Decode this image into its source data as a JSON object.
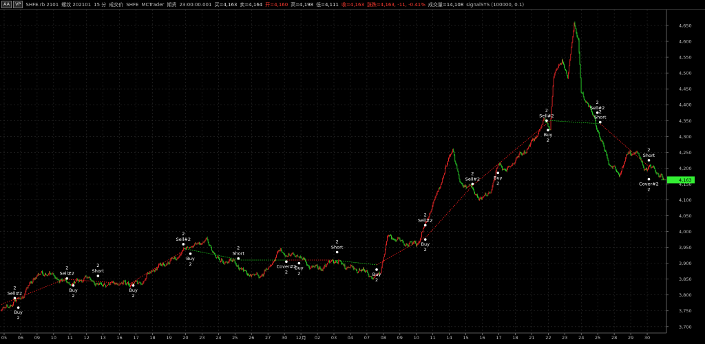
{
  "toolbar": {
    "buttons": [
      "AA",
      "VP"
    ],
    "symbol": "SHFE.rb 2101",
    "instrument": "螺纹 202101",
    "interval": "15 分",
    "tags": [
      "成交价",
      "SHFE",
      "MCTrader",
      "期货"
    ],
    "time": "23:00:00.001",
    "fields": [
      {
        "label": "买",
        "value": "=4,163",
        "red": false
      },
      {
        "label": "卖",
        "value": "=4,164",
        "red": false
      },
      {
        "label": "开",
        "value": "=4,160",
        "red": true
      },
      {
        "label": "高",
        "value": "=4,198",
        "red": false
      },
      {
        "label": "低",
        "value": "=4,111",
        "red": false
      },
      {
        "label": "收",
        "value": "=4,163",
        "red": true
      },
      {
        "label": "涨跌",
        "value": "=4,163, -11, -0.41%",
        "red": true
      },
      {
        "label": "成交量",
        "value": "=14,108",
        "red": false
      }
    ],
    "signal": "signalSYS (100000, 0.1)"
  },
  "chart_data": {
    "type": "candlestick",
    "title": "SHFE.rb 2101 螺纹 202101 15 分",
    "ylim": [
      3680,
      4700
    ],
    "y_ticks": [
      3700,
      3750,
      3800,
      3850,
      3900,
      3950,
      4000,
      4050,
      4100,
      4150,
      4200,
      4250,
      4300,
      4350,
      4400,
      4450,
      4500,
      4550,
      4600,
      4650
    ],
    "y_tick_labels": [
      "3,700",
      "3,750",
      "3,800",
      "3,850",
      "3,900",
      "3,950",
      "4,000",
      "4,050",
      "4,100",
      "4,150",
      "4,200",
      "4,250",
      "4,300",
      "4,350",
      "4,400",
      "4,450",
      "4,500",
      "4,550",
      "4,600",
      "4,650"
    ],
    "x_ticks": [
      "05",
      "06",
      "09",
      "10",
      "11",
      "12",
      "13",
      "16",
      "17",
      "18",
      "19",
      "20",
      "23",
      "24",
      "25",
      "26",
      "27",
      "30",
      "12月",
      "02",
      "03",
      "04",
      "07",
      "08",
      "09",
      "10",
      "11",
      "14",
      "15",
      "16",
      "17",
      "18",
      "21",
      "22",
      "23",
      "24",
      "25",
      "28",
      "29",
      "30"
    ],
    "n_bars": 940,
    "grid": true,
    "last_price": 4163,
    "last_price_label": "4,163",
    "colors": {
      "up": "#ff2a2a",
      "down": "#2ee82e",
      "background": "#000000",
      "last_price_tag": "#33ee33",
      "trend_up": "#ff2020",
      "trend_down": "#22dd22"
    },
    "anchors": [
      [
        0,
        3750
      ],
      [
        15,
        3772
      ],
      [
        30,
        3795
      ],
      [
        48,
        3860
      ],
      [
        65,
        3870
      ],
      [
        85,
        3845
      ],
      [
        100,
        3835
      ],
      [
        120,
        3855
      ],
      [
        140,
        3830
      ],
      [
        160,
        3838
      ],
      [
        182,
        3835
      ],
      [
        200,
        3840
      ],
      [
        215,
        3880
      ],
      [
        235,
        3900
      ],
      [
        250,
        3920
      ],
      [
        265,
        3955
      ],
      [
        275,
        3955
      ],
      [
        290,
        3975
      ],
      [
        296,
        3950
      ],
      [
        310,
        3905
      ],
      [
        330,
        3905
      ],
      [
        345,
        3870
      ],
      [
        365,
        3860
      ],
      [
        380,
        3885
      ],
      [
        393,
        3940
      ],
      [
        406,
        3925
      ],
      [
        422,
        3925
      ],
      [
        436,
        3890
      ],
      [
        455,
        3885
      ],
      [
        470,
        3910
      ],
      [
        490,
        3890
      ],
      [
        506,
        3880
      ],
      [
        520,
        3870
      ],
      [
        528,
        3850
      ],
      [
        537,
        3870
      ],
      [
        548,
        3985
      ],
      [
        562,
        3975
      ],
      [
        575,
        3960
      ],
      [
        592,
        3965
      ],
      [
        604,
        4040
      ],
      [
        618,
        4120
      ],
      [
        630,
        4200
      ],
      [
        640,
        4265
      ],
      [
        650,
        4150
      ],
      [
        665,
        4140
      ],
      [
        680,
        4100
      ],
      [
        695,
        4130
      ],
      [
        705,
        4220
      ],
      [
        715,
        4190
      ],
      [
        730,
        4230
      ],
      [
        745,
        4260
      ],
      [
        758,
        4300
      ],
      [
        770,
        4350
      ],
      [
        778,
        4330
      ],
      [
        783,
        4490
      ],
      [
        795,
        4545
      ],
      [
        803,
        4480
      ],
      [
        812,
        4660
      ],
      [
        818,
        4600
      ],
      [
        822,
        4440
      ],
      [
        832,
        4400
      ],
      [
        842,
        4350
      ],
      [
        848,
        4300
      ],
      [
        862,
        4215
      ],
      [
        876,
        4180
      ],
      [
        888,
        4245
      ],
      [
        900,
        4250
      ],
      [
        912,
        4200
      ],
      [
        925,
        4200
      ],
      [
        940,
        4160
      ]
    ],
    "trend_segments": [
      {
        "from": [
          0,
          3770
        ],
        "to": [
          90,
          3850
        ],
        "color": "red"
      },
      {
        "from": [
          90,
          3850
        ],
        "to": [
          182,
          3835
        ],
        "color": "red"
      },
      {
        "from": [
          182,
          3835
        ],
        "to": [
          262,
          3945
        ],
        "color": "red"
      },
      {
        "from": [
          262,
          3945
        ],
        "to": [
          340,
          3910
        ],
        "color": "green"
      },
      {
        "from": [
          340,
          3910
        ],
        "to": [
          405,
          3910
        ],
        "color": "green"
      },
      {
        "from": [
          405,
          3910
        ],
        "to": [
          470,
          3910
        ],
        "color": "red"
      },
      {
        "from": [
          470,
          3910
        ],
        "to": [
          532,
          3895
        ],
        "color": "green"
      },
      {
        "from": [
          532,
          3895
        ],
        "to": [
          603,
          3985
        ],
        "color": "red"
      },
      {
        "from": [
          603,
          3985
        ],
        "to": [
          668,
          4145
        ],
        "color": "red"
      },
      {
        "from": [
          668,
          4145
        ],
        "to": [
          778,
          4350
        ],
        "color": "red"
      },
      {
        "from": [
          778,
          4350
        ],
        "to": [
          849,
          4340
        ],
        "color": "green"
      },
      {
        "from": [
          849,
          4340
        ],
        "to": [
          918,
          4205
        ],
        "color": "red"
      }
    ],
    "annotations": [
      {
        "x": 19,
        "price": 3790,
        "qty": "2",
        "label": "Sell#2",
        "pos": "above"
      },
      {
        "x": 24,
        "price": 3760,
        "qty": "2",
        "label": "Buy",
        "pos": "below"
      },
      {
        "x": 93,
        "price": 3852,
        "qty": "2",
        "label": "Sell#2",
        "pos": "above"
      },
      {
        "x": 102,
        "price": 3830,
        "qty": "2",
        "label": "Buy",
        "pos": "below"
      },
      {
        "x": 137,
        "price": 3860,
        "qty": "2",
        "label": "Short",
        "pos": "above"
      },
      {
        "x": 187,
        "price": 3830,
        "qty": "2",
        "label": "Buy",
        "pos": "below"
      },
      {
        "x": 258,
        "price": 3960,
        "qty": "2",
        "label": "Sell#2",
        "pos": "above"
      },
      {
        "x": 268,
        "price": 3930,
        "qty": "2",
        "label": "Buy",
        "pos": "below"
      },
      {
        "x": 336,
        "price": 3915,
        "qty": "2",
        "label": "Short",
        "pos": "above"
      },
      {
        "x": 404,
        "price": 3905,
        "qty": "2",
        "label": "Cover#2",
        "pos": "below"
      },
      {
        "x": 422,
        "price": 3900,
        "qty": "2",
        "label": "Buy",
        "pos": "below"
      },
      {
        "x": 476,
        "price": 3935,
        "qty": "2",
        "label": "Short",
        "pos": "above"
      },
      {
        "x": 532,
        "price": 3880,
        "qty": "2",
        "label": "Buy",
        "pos": "below"
      },
      {
        "x": 601,
        "price": 4020,
        "qty": "2",
        "label": "Sell#2",
        "pos": "above"
      },
      {
        "x": 601,
        "price": 3975,
        "qty": "2",
        "label": "Buy",
        "pos": "below"
      },
      {
        "x": 668,
        "price": 4150,
        "qty": "2",
        "label": "Sell#2",
        "pos": "above"
      },
      {
        "x": 704,
        "price": 4185,
        "qty": "2",
        "label": "Buy",
        "pos": "below"
      },
      {
        "x": 773,
        "price": 4350,
        "qty": "2",
        "label": "Sell#2",
        "pos": "above"
      },
      {
        "x": 775,
        "price": 4320,
        "qty": "2",
        "label": "Buy",
        "pos": "below"
      },
      {
        "x": 845,
        "price": 4375,
        "qty": "2",
        "label": "Sell#2",
        "pos": "above"
      },
      {
        "x": 849,
        "price": 4345,
        "qty": "2",
        "label": "Short",
        "pos": "above"
      },
      {
        "x": 918,
        "price": 4225,
        "qty": "2",
        "label": "Short",
        "pos": "above"
      },
      {
        "x": 918,
        "price": 4165,
        "qty": "2",
        "label": "Cover#2",
        "pos": "below"
      }
    ]
  }
}
